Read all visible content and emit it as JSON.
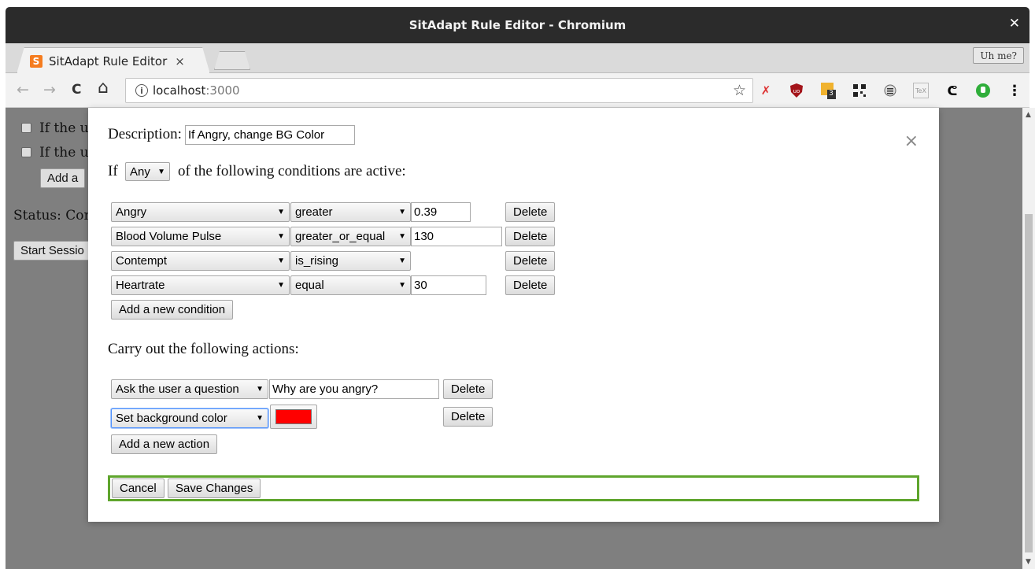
{
  "window": {
    "title": "SitAdapt Rule Editor - Chromium",
    "close_glyph": "✕"
  },
  "tabs": [
    {
      "label": "SitAdapt Rule Editor",
      "favicon": "S",
      "close_glyph": "×"
    }
  ],
  "profile_label": "Uh me?",
  "toolbar": {
    "back": "←",
    "forward": "→",
    "reload": "C",
    "home": "⌂",
    "url_host": "localhost",
    "url_port": ":3000",
    "info_glyph": "i",
    "star": "☆"
  },
  "extensions": [
    "red-x-icon",
    "ublock-icon",
    "notes-icon",
    "qr-icon",
    "menu-list-icon",
    "tex-icon",
    "paw-icon",
    "green-power-icon"
  ],
  "extension_badge": "3",
  "background": {
    "rule_1": "If the us",
    "rule_2": "If the us",
    "add_btn": "Add a",
    "status": "Status: Con",
    "start_btn": "Start Sessio"
  },
  "modal": {
    "description_label": "Description:",
    "description_value": "If Angry, change BG Color",
    "close_glyph": "×",
    "if_label": "If",
    "match_mode": "Any",
    "conditions_text": "of the following conditions are active:",
    "conditions": [
      {
        "sensor": "Angry",
        "operator": "greater",
        "value": "0.39",
        "delete": "Delete"
      },
      {
        "sensor": "Blood Volume Pulse",
        "operator": "greater_or_equal",
        "value": "130",
        "delete": "Delete"
      },
      {
        "sensor": "Contempt",
        "operator": "is_rising",
        "value": "",
        "delete": "Delete"
      },
      {
        "sensor": "Heartrate",
        "operator": "equal",
        "value": "30",
        "delete": "Delete"
      }
    ],
    "add_condition": "Add a new condition",
    "actions_heading": "Carry out the following actions:",
    "actions": [
      {
        "type": "Ask the user a question",
        "value": "Why are you angry?",
        "delete": "Delete"
      },
      {
        "type": "Set background color",
        "color": "#ff0000",
        "delete": "Delete"
      }
    ],
    "add_action": "Add a new action",
    "cancel": "Cancel",
    "save": "Save Changes"
  },
  "colors": {
    "accent_green": "#5fa52d",
    "swatch_red": "#ff0000",
    "overlay": "#7f7f7f"
  }
}
